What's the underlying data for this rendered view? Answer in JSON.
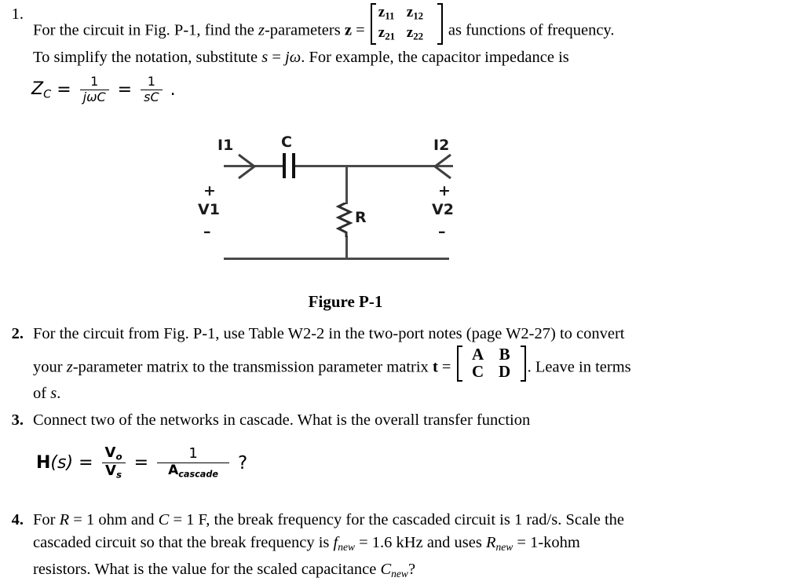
{
  "document": {
    "title": "Two-Port Network Problem Set"
  },
  "problems": [
    {
      "number": "1.",
      "bold_number": false,
      "lines": [
        "For the circuit in Fig. P-1, find the z-parameters  z  =",
        "as functions of frequency.",
        "To simplify the notation, substitute s = jω.  For example, the capacitor impedance is"
      ],
      "matrix": {
        "rows": [
          [
            "z11",
            "z12"
          ],
          [
            "z21",
            "z22"
          ]
        ]
      }
    },
    {
      "number": "2.",
      "bold_number": true,
      "lines": [
        "For the circuit from Fig. P-1, use Table W2-2 in the two-port notes (page W2-27) to convert",
        "your z-parameter matrix to the transmission parameter matrix t =",
        ".  Leave in terms",
        "of s."
      ],
      "matrix": {
        "rows": [
          [
            "A",
            "B"
          ],
          [
            "C",
            "D"
          ]
        ]
      }
    },
    {
      "number": "3.",
      "bold_number": true,
      "lines": [
        "Connect two of the networks in cascade.  What is the overall transfer function"
      ]
    },
    {
      "number": "4.",
      "bold_number": true,
      "lines": [
        "For R = 1 ohm and C = 1 F, the break frequency for the cascaded circuit is 1 rad/s.  Scale the",
        "cascaded circuit so that the break frequency is fnew = 1.6 kHz and uses Rnew = 1-kohm",
        "resistors.  What is the value for the scaled capacitance Cnew?"
      ]
    }
  ],
  "equation_zc": {
    "lhs": "Z",
    "lhs_sub": "C",
    "eq1": "=",
    "frac1_num": "1",
    "frac1_den": "jωC",
    "eq2": "=",
    "frac2_num": "1",
    "frac2_den": "sC",
    "period": "."
  },
  "equation_h": {
    "lhs": "H",
    "lhs_arg": "(s)",
    "eq1": "=",
    "frac1_num": "V",
    "frac1_num_sub": "o",
    "frac1_den": "V",
    "frac1_den_sub": "s",
    "eq2": "=",
    "frac2_num": "1",
    "frac2_den": "A",
    "frac2_den_sub": "cascade",
    "question": "?"
  },
  "figure": {
    "caption": "Figure P-1",
    "labels": {
      "i1": "I1",
      "i2": "I2",
      "c": "C",
      "r": "R",
      "v1": "V1",
      "v2": "V2",
      "plus1": "+",
      "minus1": "–",
      "plus2": "+",
      "minus2": "–"
    }
  },
  "text_fragments": {
    "p1_a": "For the circuit in Fig. P-1, find the ",
    "p1_z": "z",
    "p1_b": "-parameters ",
    "p1_zbold": "z",
    "p1_eq": " = ",
    "p1_c": " as functions of frequency.",
    "p1_line2_a": "To simplify the notation, substitute ",
    "p1_line2_s": "s",
    "p1_line2_b": " = ",
    "p1_line2_jw": "jω",
    "p1_line2_c": ".  For example, the capacitor impedance is",
    "p2_l1": "For the circuit from Fig. P-1, use Table W2-2 in the two-port notes (page W2-27) to convert",
    "p2_l2_a": "your ",
    "p2_l2_z": "z",
    "p2_l2_b": "-parameter matrix to the transmission parameter matrix ",
    "p2_l2_t": "t",
    "p2_l2_eq": " = ",
    "p2_l2_c": ".  Leave in terms",
    "p2_l3_a": "of ",
    "p2_l3_s": "s",
    "p2_l3_b": ".",
    "p3_l1": "Connect two of the networks in cascade.  What is the overall transfer function",
    "p4_l1_a": "For ",
    "p4_l1_R": "R",
    "p4_l1_b": " = 1 ohm and ",
    "p4_l1_C": "C",
    "p4_l1_c": " = 1 F, the break frequency for the cascaded circuit is 1 rad/s.  Scale the",
    "p4_l2_a": "cascaded circuit so that the break frequency is ",
    "p4_l2_f": "f",
    "p4_l2_fsub": "new",
    "p4_l2_b": " = 1.6 kHz and uses ",
    "p4_l2_R": "R",
    "p4_l2_Rsub": "new",
    "p4_l2_c": " = 1-kohm",
    "p4_l3_a": "resistors.  What is the value for the scaled capacitance ",
    "p4_l3_C": "C",
    "p4_l3_Csub": "new",
    "p4_l3_b": "?"
  },
  "colors": {
    "background": "#ffffff",
    "text": "#000000",
    "wire": "#4a4a4a",
    "component": "#111111"
  }
}
